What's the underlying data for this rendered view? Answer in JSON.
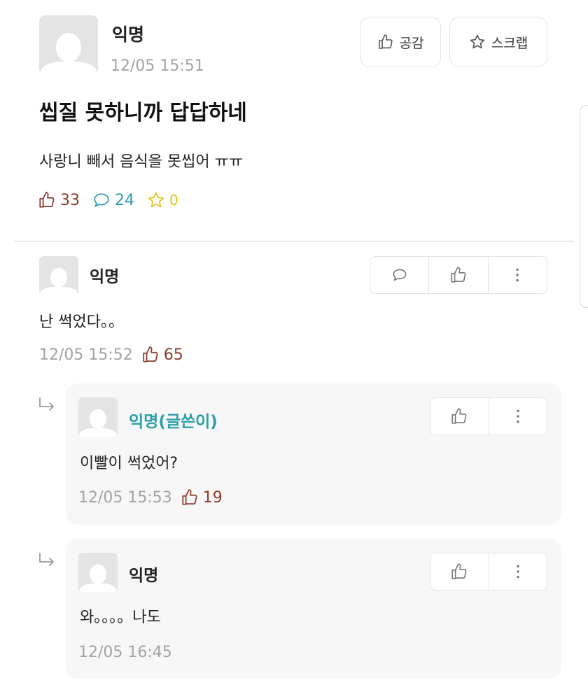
{
  "post": {
    "author": "익명",
    "date": "12/05 15:51",
    "title": "씹질 못하니까 답답하네",
    "body": "사랑니 빼서 음식을 못씹어 ㅠㅠ",
    "like_label": "공감",
    "scrap_label": "스크랩",
    "likes": "33",
    "comments": "24",
    "scraps": "0"
  },
  "comments": [
    {
      "author": "익명",
      "text": "난 썩었다。。",
      "date": "12/05 15:52",
      "likes": "65"
    }
  ],
  "replies": [
    {
      "author": "익명(글쓴이)",
      "text": "이빨이 썩었어?",
      "date": "12/05 15:53",
      "likes": "19"
    },
    {
      "author": "익명",
      "text": "와。。。。나도",
      "date": "12/05 16:45"
    }
  ],
  "colors": {
    "like": "#8b3a2a",
    "comment": "#2a9bb0",
    "scrap": "#e3c11a",
    "op_author": "#2aa0a8",
    "meta": "#a3a3a3"
  },
  "icons": [
    "thumbs-up-icon",
    "star-icon",
    "speech-bubble-icon",
    "more-vertical-icon",
    "reply-arrow-icon",
    "avatar-icon"
  ]
}
